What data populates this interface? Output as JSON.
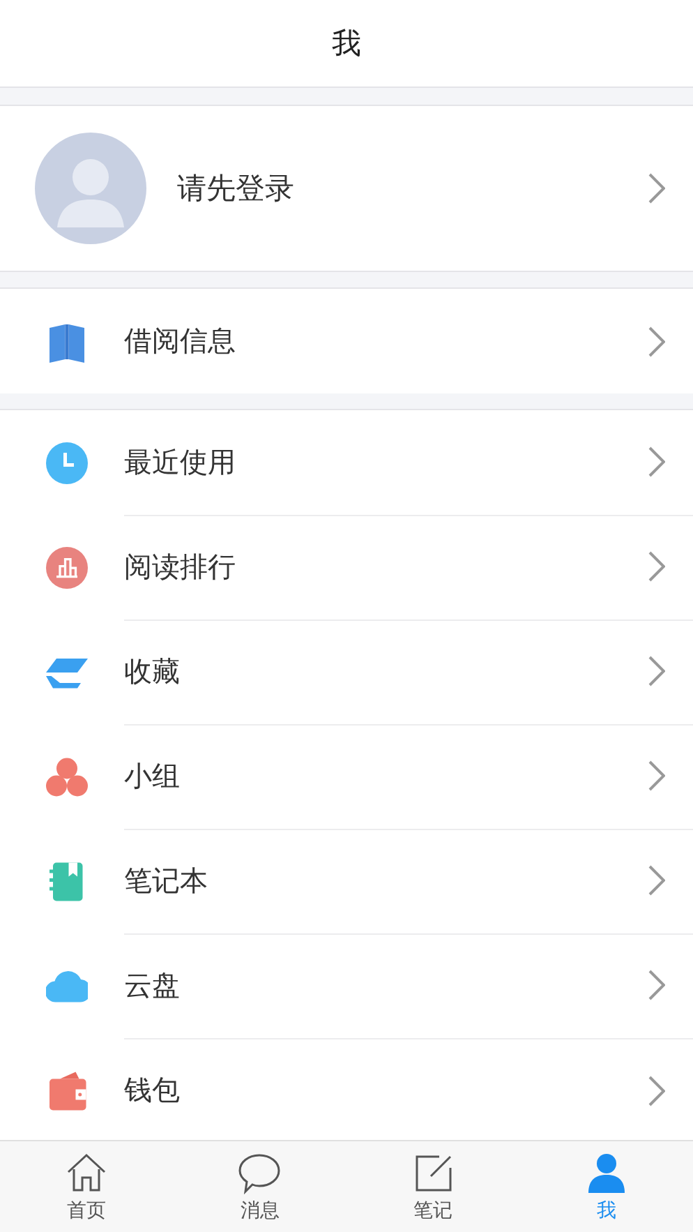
{
  "header": {
    "title": "我"
  },
  "profile": {
    "name": "请先登录"
  },
  "sections": [
    {
      "items": [
        {
          "label": "借阅信息"
        }
      ]
    },
    {
      "items": [
        {
          "label": "最近使用"
        },
        {
          "label": "阅读排行"
        },
        {
          "label": "收藏"
        },
        {
          "label": "小组"
        },
        {
          "label": "笔记本"
        },
        {
          "label": "云盘"
        },
        {
          "label": "钱包"
        }
      ]
    }
  ],
  "tab_bar": [
    {
      "label": "首页",
      "selected": false
    },
    {
      "label": "消息",
      "selected": false
    },
    {
      "label": "笔记",
      "selected": false
    },
    {
      "label": "我",
      "selected": true
    }
  ]
}
